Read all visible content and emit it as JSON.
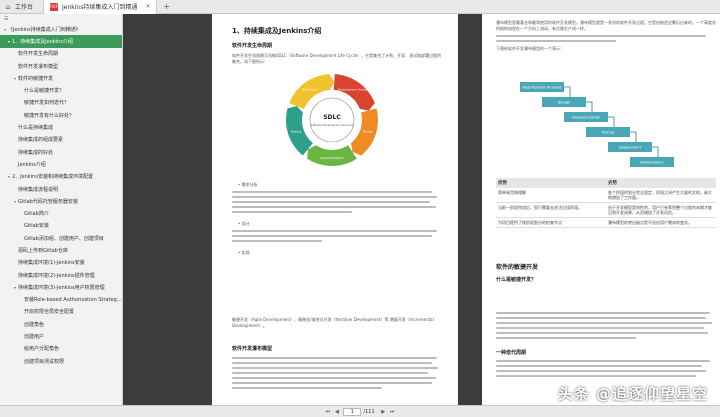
{
  "topbar": {
    "workspace_label": "工作台",
    "tab_title": "Jenkins持续集成入门到精通"
  },
  "sidebar": {
    "title": "Jenkins持续集成入门到精通",
    "items": [
      {
        "label": "《Jenkins持续集成入门到精通》",
        "level": 0,
        "caret": "▾",
        "active": false
      },
      {
        "label": "1、持续集成及Jenkins介绍",
        "level": 1,
        "caret": "▾",
        "active": true
      },
      {
        "label": "软件开发生命周期",
        "level": 2,
        "caret": "",
        "active": false
      },
      {
        "label": "软件开发瀑布模型",
        "level": 2,
        "caret": "",
        "active": false
      },
      {
        "label": "软件的敏捷开发",
        "level": 2,
        "caret": "▾",
        "active": false
      },
      {
        "label": "什么是敏捷开发？",
        "level": 3,
        "caret": "",
        "active": false
      },
      {
        "label": "敏捷开发如何迭代？",
        "level": 3,
        "caret": "",
        "active": false
      },
      {
        "label": "敏捷开发有什么好处？",
        "level": 3,
        "caret": "",
        "active": false
      },
      {
        "label": "什么是持续集成",
        "level": 2,
        "caret": "",
        "active": false
      },
      {
        "label": "持续集成的组成要素",
        "level": 2,
        "caret": "",
        "active": false
      },
      {
        "label": "持续集成的好处",
        "level": 2,
        "caret": "",
        "active": false
      },
      {
        "label": "Jenkins介绍",
        "level": 2,
        "caret": "",
        "active": false
      },
      {
        "label": "2、Jenkins安装和持续集成环境配置",
        "level": 1,
        "caret": "▾",
        "active": false
      },
      {
        "label": "持续集成流程说明",
        "level": 2,
        "caret": "",
        "active": false
      },
      {
        "label": "Gitlab代码托管服务器安装",
        "level": 2,
        "caret": "▾",
        "active": false
      },
      {
        "label": "Gitlab简介",
        "level": 3,
        "caret": "",
        "active": false
      },
      {
        "label": "Gitlab安装",
        "level": 3,
        "caret": "",
        "active": false
      },
      {
        "label": "Gitlab添加组、创建用户、创建项目",
        "level": 3,
        "caret": "",
        "active": false
      },
      {
        "label": "源码上传到Gitlab仓库",
        "level": 2,
        "caret": "",
        "active": false
      },
      {
        "label": "持续集成环境(1)-Jenkins安装",
        "level": 2,
        "caret": "",
        "active": false
      },
      {
        "label": "持续集成环境(2)-Jenkins插件管理",
        "level": 2,
        "caret": "",
        "active": false
      },
      {
        "label": "持续集成环境(3)-Jenkins用户权限管理",
        "level": 2,
        "caret": "▾",
        "active": false
      },
      {
        "label": "安装Role-based Authorization Strateg...",
        "level": 3,
        "caret": "",
        "active": false
      },
      {
        "label": "开启权限全局安全配置",
        "level": 3,
        "caret": "",
        "active": false
      },
      {
        "label": "创建角色",
        "level": 3,
        "caret": "",
        "active": false
      },
      {
        "label": "创建用户",
        "level": 3,
        "caret": "",
        "active": false
      },
      {
        "label": "给用户分配角色",
        "level": 3,
        "caret": "",
        "active": false
      },
      {
        "label": "创建项目测试权限",
        "level": 3,
        "caret": "",
        "active": false
      }
    ]
  },
  "page1": {
    "title": "1、持续集成及Jenkins介绍",
    "section1": "软件开发生命周期",
    "intro": "软件开发生命周期又叫做SDLC（Software Development Life Cycle），它是集合了计划、开发、测试和部署过程的集合。如下图所示：",
    "sdlc_center": "SDLC",
    "sdlc_center_sub": "Software Development Life Cycle",
    "sdlc_phases": [
      "Requirement Analysis",
      "Design",
      "Implementation",
      "Testing",
      "Evolution"
    ],
    "bullet_analysis": "需求分析",
    "bullet_design": "设计",
    "bullet_impl": "实现",
    "bottom_para": "敏捷开发（Agile Development）、精细化/渐进式开发（Iterative Development）等 增量开发（Incremental Development）。",
    "section2": "软件开发瀑布模型"
  },
  "page2": {
    "top_para": "瀑布模型是最著名和最常使用的软件开发模型。瀑布模型就是一系列的软件开发过程。它是由制造业繁衍出来的。一个高度化的结构流程在一个方向上流动，有点像生产线一样。",
    "waterfall_caption": "下图给软件开发瀑布模型的一个演示：",
    "waterfall_steps": [
      "Requirement Analysis",
      "Design",
      "Implementation",
      "Testing",
      "Deployment",
      "Maintenance"
    ],
    "table_headers": [
      "优势",
      "劣势"
    ],
    "table_rows": [
      [
        "简单易用和理解",
        "各个阶段的划分完全固定，阶段之间产生大量的文档，极大地增加了工作量。"
      ],
      [
        "当前一阶段完成后，您只需要去关注后续阶段。",
        "由于开发模型是线性的，用户只有等到整个过程的末期才能见到开发成果，从而增加了开发风险。"
      ],
      [
        "为项目提供了按阶段划分的检查节点",
        "瀑布模型的突出缺点是不适应用户需求的变化。"
      ]
    ],
    "section_agile": "软件的敏捷开发",
    "section_what": "什么是敏捷开发？",
    "section_iter": "一种迭代周期"
  },
  "bottombar": {
    "page_current": "1",
    "page_total": "/111"
  },
  "watermark": "头条 @追逐仰望星空",
  "colors": {
    "active": "#3c9a5a",
    "waterfall": "#4aa7b8",
    "cycle_red": "#d9432f",
    "cycle_orange": "#f08a24",
    "cycle_yellow": "#f2c12e",
    "cycle_green": "#6bb543",
    "cycle_teal": "#2d9f8b"
  }
}
